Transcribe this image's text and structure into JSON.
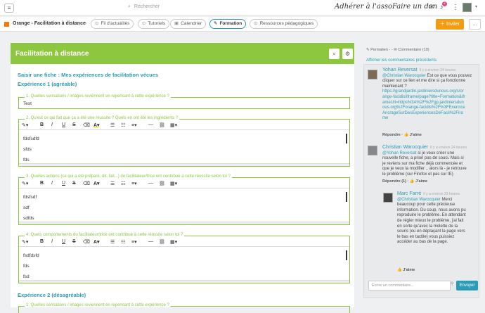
{
  "topbar": {
    "search_placeholder": "Rechercher",
    "adherer": "Adhérer à l'asso",
    "don": "Faire un don",
    "notif_count": "2"
  },
  "subbar": {
    "group": "Orange - Facilitation à distance",
    "tabs": [
      "Fil d'actualités",
      "Tutoriels",
      "Calendrier",
      "Formation",
      "Ressources pédagogiques"
    ],
    "invite": "Inviter",
    "more": "..."
  },
  "main": {
    "title": "Facilitation à distance",
    "saisir": "Saisir une fiche :  Mes expériences de facilitation vécues",
    "exp1": "Expérience 1 (agréable)",
    "exp2": "Expérience 2 (désagréable)",
    "q1": "1. Quelles sensations / images reviennent en repensant à cette expérience ?",
    "a1": "Test",
    "q2": "2. Qu'est ce qui fait que ça a été une réussite ? Quels en ont été les ingrédients ?",
    "a2": [
      "fdsfsdfd",
      "sfds",
      "fds"
    ],
    "q3": "3. Quelles actions (ce qui a été préparé, dit, fait...) du facilitateur/trice ont contribué à cette réussite selon toi ?",
    "a3": [
      "fdsfsdf",
      "sdf",
      "sdfds"
    ],
    "q4": "4. Quels comportements du facilitateur/trice ont contribué à cette réussite selon toi ?",
    "a4": [
      "fsdfdsfd",
      "fds",
      "fsd"
    ],
    "q5": "1. Quelles sensations / images reviennent en repensant à cette expérience ?"
  },
  "toolbar": {
    "magic": "✎▾",
    "bold": "B",
    "italic": "I",
    "underline": "U",
    "strike": "S",
    "eraser": "⌫",
    "color": "A▾",
    "ul": "☰",
    "ol": "☷",
    "para": "≡▾",
    "hr": "—",
    "link": "⛓",
    "table": "▦▾"
  },
  "side": {
    "top": "✎ Permalien - - ✉ Commentaire (10)",
    "show": "Afficher les commentaires précédents",
    "c1": {
      "name": "Yohan Reversat",
      "time": "Il y a environ 24 heures",
      "mention": "@Christian Warocquier",
      "body": "Est ce que vous pouvez cliquer sur ce lien et me dire si ça fonctionne maintenant ?",
      "url": "https://grandjardin.jardiniersdunous.org/s/orange-facidis/iframe/page?title=Formation&iframeUrl=https%3A%2F%2Fgp.jardiniersdunous.org%2Forange-facidis%2F%3FExerciceAncrageSurDesExperiencesDeFacil%2Firame",
      "actions": "Répondre · 👍 J'aime"
    },
    "c2": {
      "name": "Christian Warocquier",
      "time": "Il y a environ 24 heures",
      "mention": "@Yohan Reversat",
      "body": "si je veux créer une nouvelle fiche, a priori pas de souci. Mais si je reviens sur ma fiche déjà commencée et que je veux la modifier .. alors là - je retrouve le problème (sur Firefox et pas sur IE)",
      "actions": "Répondre (1) · 👍 J'aime"
    },
    "c3": {
      "name": "Marc Farré",
      "time": "Il y a environ 23 heures",
      "mention": "@Christian Warocquier",
      "body": "Merci beaucoup pour cette précieuse information. Du coup, nous avons pu reproduire le problème. En attendant de régler mieux le problème, j'ai fait en sorte qu'avec la molette de la souris (ou en déplaçant la page vers le bas en tactile) vous puissiez accéder au bas de la page.",
      "actions": "👍 J'aime"
    },
    "reply_placeholder": "Écrire un commentaire...",
    "send": "Envoyer"
  }
}
